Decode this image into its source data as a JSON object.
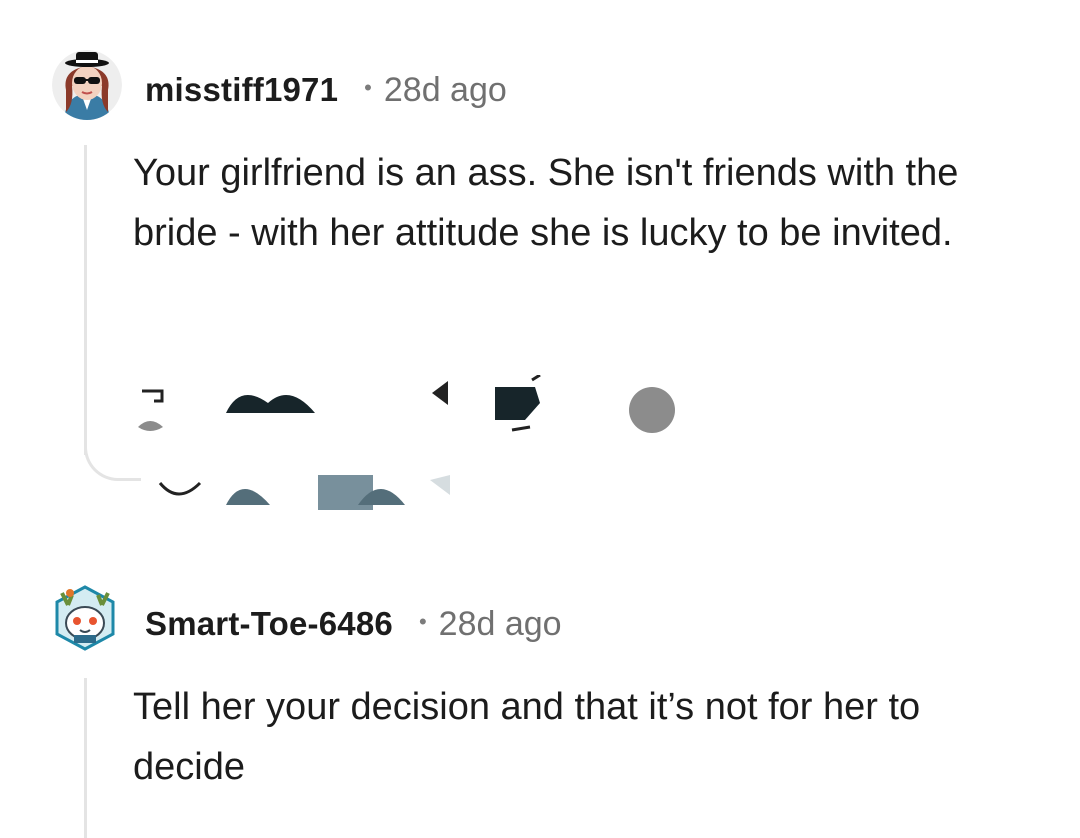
{
  "comments": [
    {
      "username": "misstiff1971",
      "separator": "•",
      "time": "28d ago",
      "body": "Your girlfriend is an ass. She isn't friends with the bride - with her attitude she is lucky to be invited.",
      "avatar_icon": "avatar-woman-sunglasses-hat-icon"
    },
    {
      "username": "Smart-Toe-6486",
      "separator": "•",
      "time": "28d ago",
      "body": "Tell her your decision and that it’s not for her to decide",
      "avatar_icon": "avatar-antlered-creature-icon"
    }
  ],
  "colors": {
    "text": "#1c1c1c",
    "meta": "#707070",
    "thread_line": "#e4e4e4"
  }
}
